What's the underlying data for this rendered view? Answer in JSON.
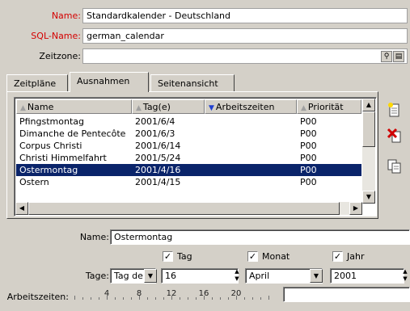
{
  "header": {
    "name_label": "Name:",
    "name_value": "Standardkalender - Deutschland",
    "sql_label": "SQL-Name:",
    "sql_value": "german_calendar",
    "timezone_label": "Zeitzone:",
    "timezone_value": ""
  },
  "tabs": [
    {
      "label": "Zeitpläne",
      "active": false
    },
    {
      "label": "Ausnahmen",
      "active": true
    },
    {
      "label": "Seitenansicht",
      "active": false
    }
  ],
  "table": {
    "columns": [
      "Name",
      "Tag(e)",
      "Arbeitszeiten",
      "Priorität"
    ],
    "rows": [
      {
        "name": "Pfingstmontag",
        "date": "2001/6/4",
        "hours": "",
        "priority": "P00",
        "selected": false
      },
      {
        "name": "Dimanche de Pentecôte",
        "date": "2001/6/3",
        "hours": "",
        "priority": "P00",
        "selected": false
      },
      {
        "name": "Corpus Christi",
        "date": "2001/6/14",
        "hours": "",
        "priority": "P00",
        "selected": false
      },
      {
        "name": "Christi Himmelfahrt",
        "date": "2001/5/24",
        "hours": "",
        "priority": "P00",
        "selected": false
      },
      {
        "name": "Ostermontag",
        "date": "2001/4/16",
        "hours": "",
        "priority": "P00",
        "selected": true
      },
      {
        "name": "Ostern",
        "date": "2001/4/15",
        "hours": "",
        "priority": "P00",
        "selected": false
      }
    ]
  },
  "toolbar": {
    "new_icon": "new-document-icon",
    "delete_icon": "delete-icon",
    "duplicate_icon": "duplicate-icon"
  },
  "detail": {
    "name_label": "Name:",
    "name_value": "Ostermontag",
    "tag_check": "Tag",
    "monat_check": "Monat",
    "jahr_check": "Jahr",
    "tage_label": "Tage:",
    "tage_value": "Tag de",
    "day_value": "16",
    "month_value": "April",
    "year_value": "2001",
    "arbeitszeiten_label": "Arbeitszeiten:",
    "ruler_labels": [
      "4",
      "8",
      "12",
      "16",
      "20"
    ]
  },
  "colors": {
    "required_label": "#d40000",
    "selection": "#0a246a",
    "window": "#d4d0c8"
  }
}
